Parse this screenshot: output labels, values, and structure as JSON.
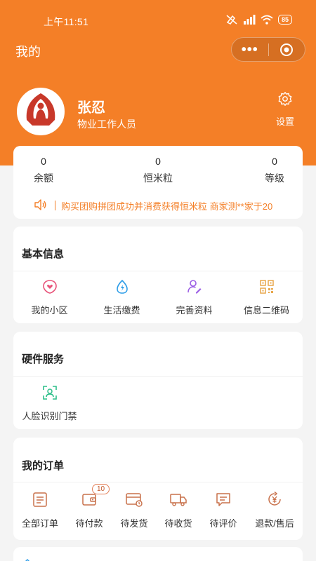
{
  "status_bar": {
    "time": "上午11:51",
    "battery": "85"
  },
  "nav": {
    "title": "我的"
  },
  "user": {
    "name": "张忍",
    "role": "物业工作人员",
    "settings_label": "设置"
  },
  "stats": [
    {
      "value": "0",
      "label": "余额"
    },
    {
      "value": "0",
      "label": "恒米粒"
    },
    {
      "value": "0",
      "label": "等级"
    }
  ],
  "marquee": {
    "text": "购买团购拼团成功并消费获得恒米粒    商家测**家于20"
  },
  "basic_info": {
    "title": "基本信息",
    "items": [
      {
        "label": "我的小区",
        "icon": "community-heart-icon"
      },
      {
        "label": "生活缴费",
        "icon": "utility-bolt-icon"
      },
      {
        "label": "完善资料",
        "icon": "profile-edit-icon"
      },
      {
        "label": "信息二维码",
        "icon": "qr-code-icon"
      }
    ]
  },
  "hardware": {
    "title": "硬件服务",
    "items": [
      {
        "label": "人脸识别门禁",
        "icon": "face-scan-icon"
      }
    ]
  },
  "orders": {
    "title": "我的订单",
    "items": [
      {
        "label": "全部订单",
        "icon": "order-list-icon"
      },
      {
        "label": "待付款",
        "icon": "wallet-icon",
        "badge": "10"
      },
      {
        "label": "待发货",
        "icon": "card-clock-icon"
      },
      {
        "label": "待收货",
        "icon": "truck-icon"
      },
      {
        "label": "待评价",
        "icon": "comment-icon"
      },
      {
        "label": "退款/售后",
        "icon": "refund-yen-icon"
      }
    ]
  },
  "colors": {
    "accent": "#f47f27",
    "icon_pink": "#e8547a",
    "icon_blue": "#2f9ee8",
    "icon_purple": "#9b5de5",
    "icon_orange": "#e8a74c",
    "icon_green": "#2fbf8a",
    "icon_order": "#c8704a"
  }
}
